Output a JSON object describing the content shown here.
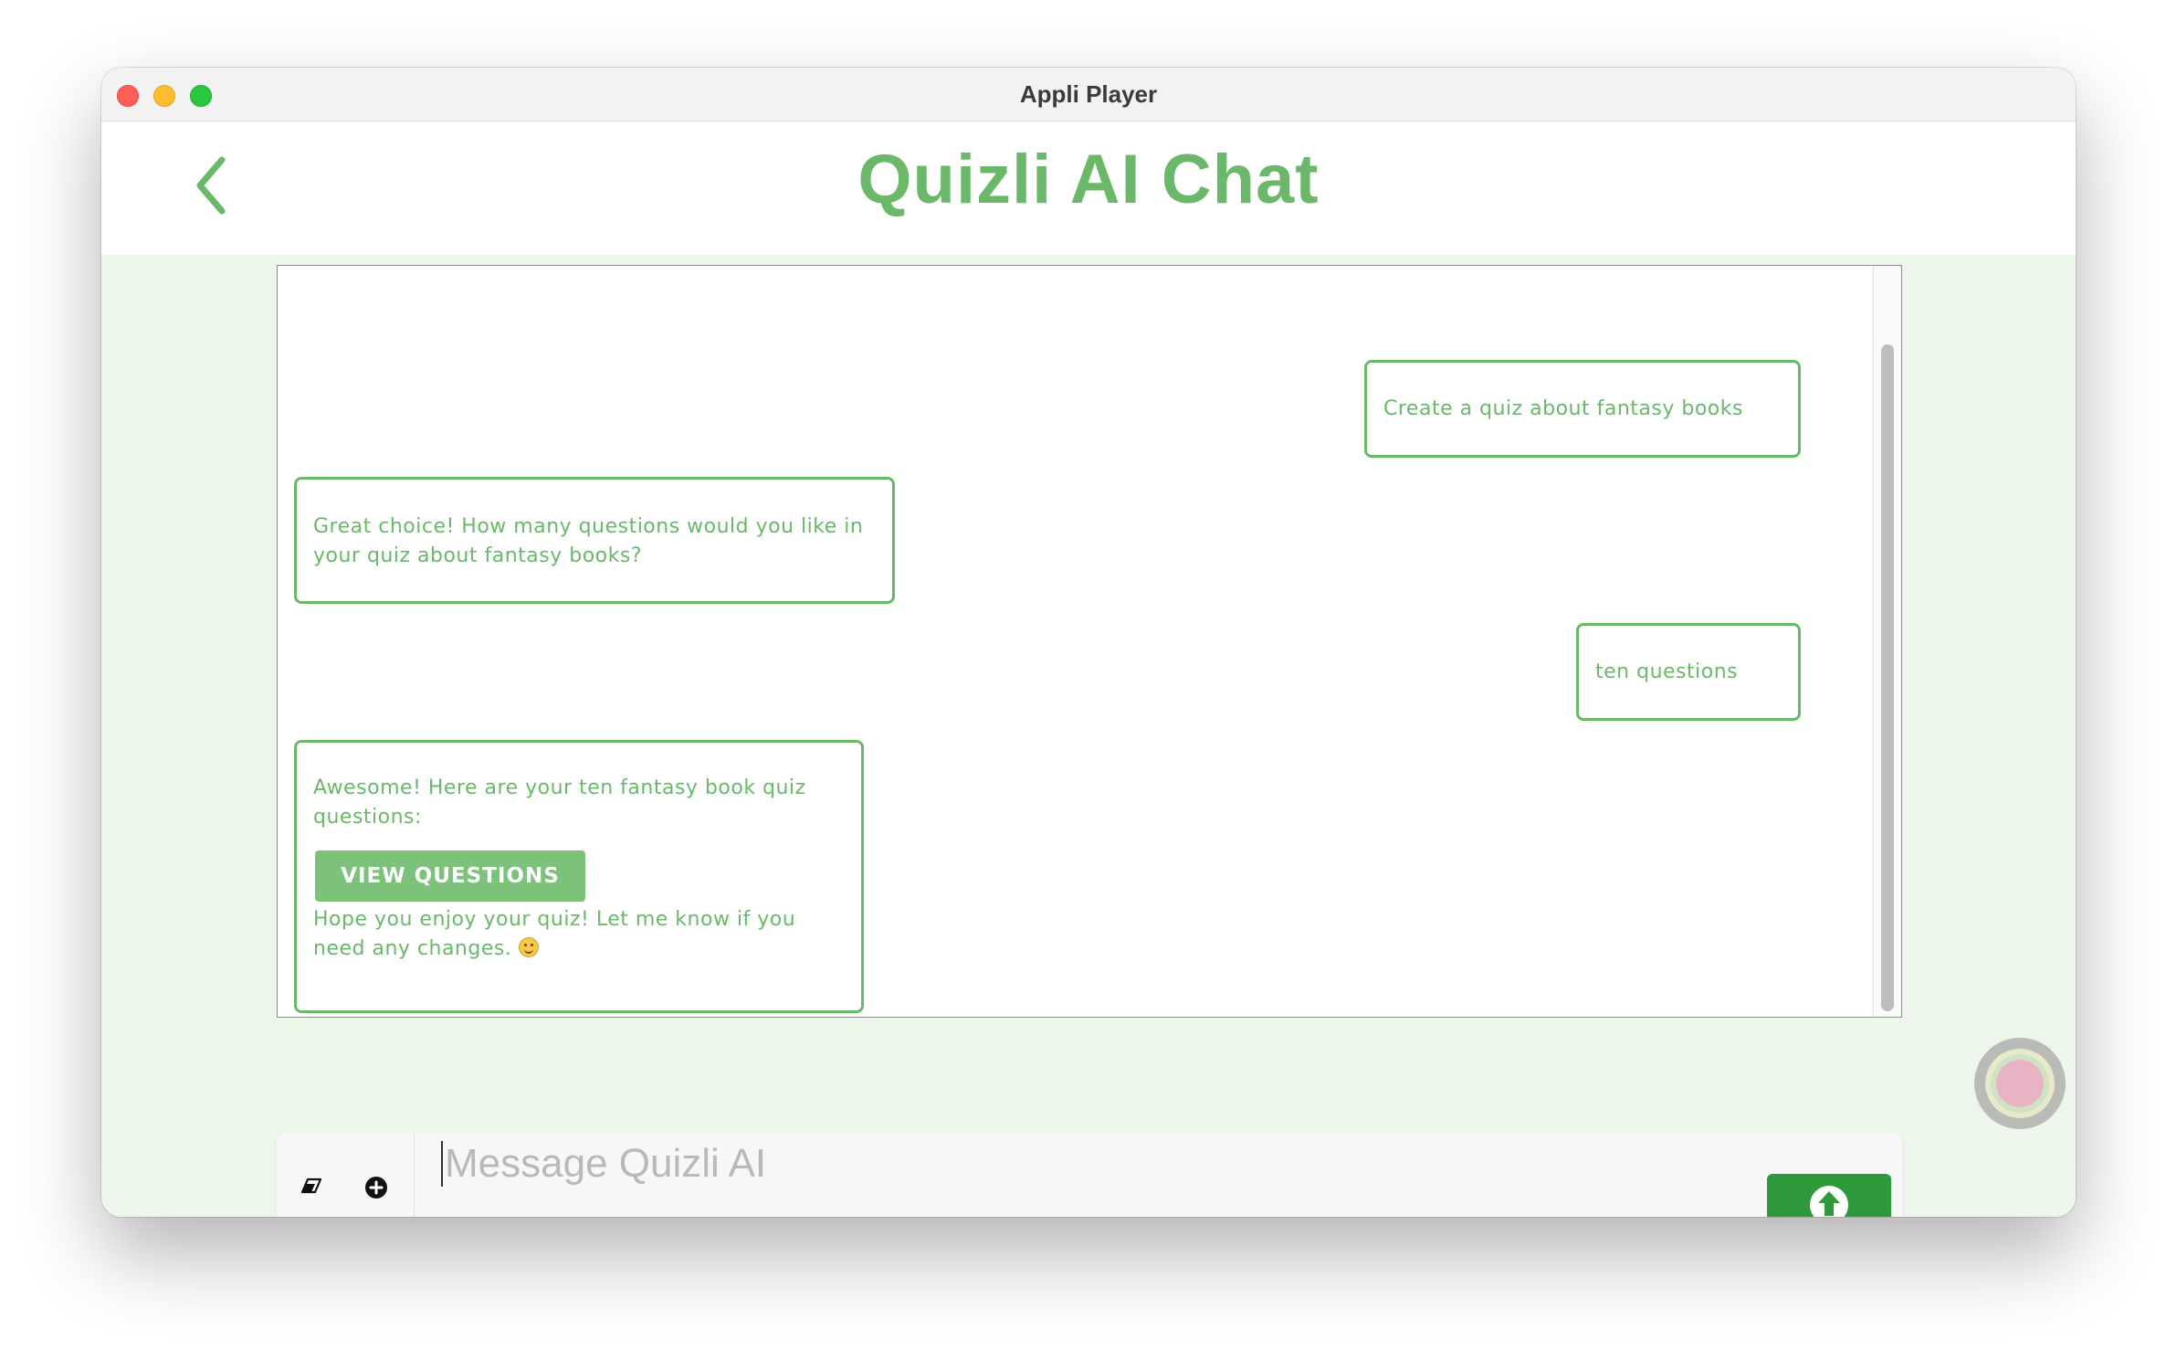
{
  "window": {
    "title": "Appli Player"
  },
  "header": {
    "title": "Quizli AI Chat"
  },
  "chat": {
    "messages": [
      {
        "role": "user",
        "text": "Create a quiz about fantasy books"
      },
      {
        "role": "assistant",
        "text": "Great choice! How many questions would you like in your quiz about fantasy books?"
      },
      {
        "role": "user",
        "text": "ten questions"
      },
      {
        "role": "assistant",
        "text": "Awesome! Here are your ten fantasy book quiz questions:",
        "button_label": "VIEW QUESTIONS",
        "text_after": "Hope you enjoy your quiz! Let me know if you need any changes."
      }
    ]
  },
  "composer": {
    "placeholder": "Message Quizli AI",
    "value": ""
  },
  "colors": {
    "accent": "#6bb86b",
    "send_button": "#2e9a3c",
    "content_background": "#edf6ea"
  },
  "icons": {
    "back": "chevron-left-icon",
    "eraser": "eraser-icon",
    "add": "plus-circle-icon",
    "send": "arrow-up-circle-icon",
    "emoji": "smiling-face-icon"
  }
}
